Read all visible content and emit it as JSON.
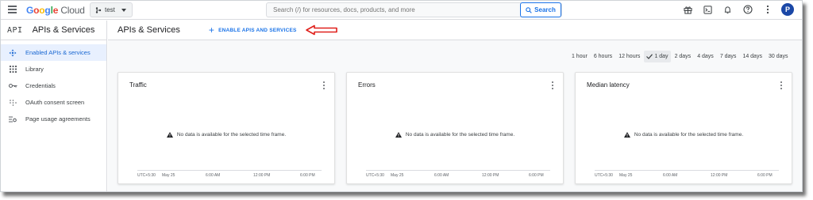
{
  "topbar": {
    "logo": {
      "g1": "G",
      "g2": "o",
      "g3": "o",
      "g4": "g",
      "g5": "l",
      "g6": "e",
      "cloud": "Cloud"
    },
    "project": "test",
    "search_placeholder": "Search (/) for resources, docs, products, and more",
    "search_button": "Search",
    "avatar_initial": "P"
  },
  "sidebar": {
    "api_glyph": "API",
    "title": "APIs & Services",
    "items": [
      {
        "label": "Enabled APIs & services",
        "icon": "hub-icon",
        "active": true
      },
      {
        "label": "Library",
        "icon": "grid-icon",
        "active": false
      },
      {
        "label": "Credentials",
        "icon": "key-icon",
        "active": false
      },
      {
        "label": "OAuth consent screen",
        "icon": "dots-icon",
        "active": false
      },
      {
        "label": "Page usage agreements",
        "icon": "settings-list-icon",
        "active": false
      }
    ]
  },
  "main": {
    "title": "APIs & Services",
    "enable_label": "ENABLE APIS AND SERVICES",
    "timeframes": [
      "1 hour",
      "6 hours",
      "12 hours",
      "1 day",
      "2 days",
      "4 days",
      "7 days",
      "14 days",
      "30 days"
    ],
    "selected_timeframe": "1 day",
    "cards": [
      {
        "title": "Traffic",
        "no_data": "No data is available for the selected time frame.",
        "axis": [
          "UTC+5:30",
          "May 25",
          "6:00 AM",
          "12:00 PM",
          "6:00 PM"
        ]
      },
      {
        "title": "Errors",
        "no_data": "No data is available for the selected time frame.",
        "axis": [
          "UTC+5:30",
          "May 25",
          "6:00 AM",
          "12:00 PM",
          "6:00 PM"
        ]
      },
      {
        "title": "Median latency",
        "no_data": "No data is available for the selected time frame.",
        "axis": [
          "UTC+5:30",
          "May 25",
          "6:00 AM",
          "12:00 PM",
          "6:00 PM"
        ]
      }
    ]
  },
  "colors": {
    "accent": "#1a73e8",
    "annotation_arrow": "#e0201b",
    "active_bg": "#e8f0fe"
  }
}
